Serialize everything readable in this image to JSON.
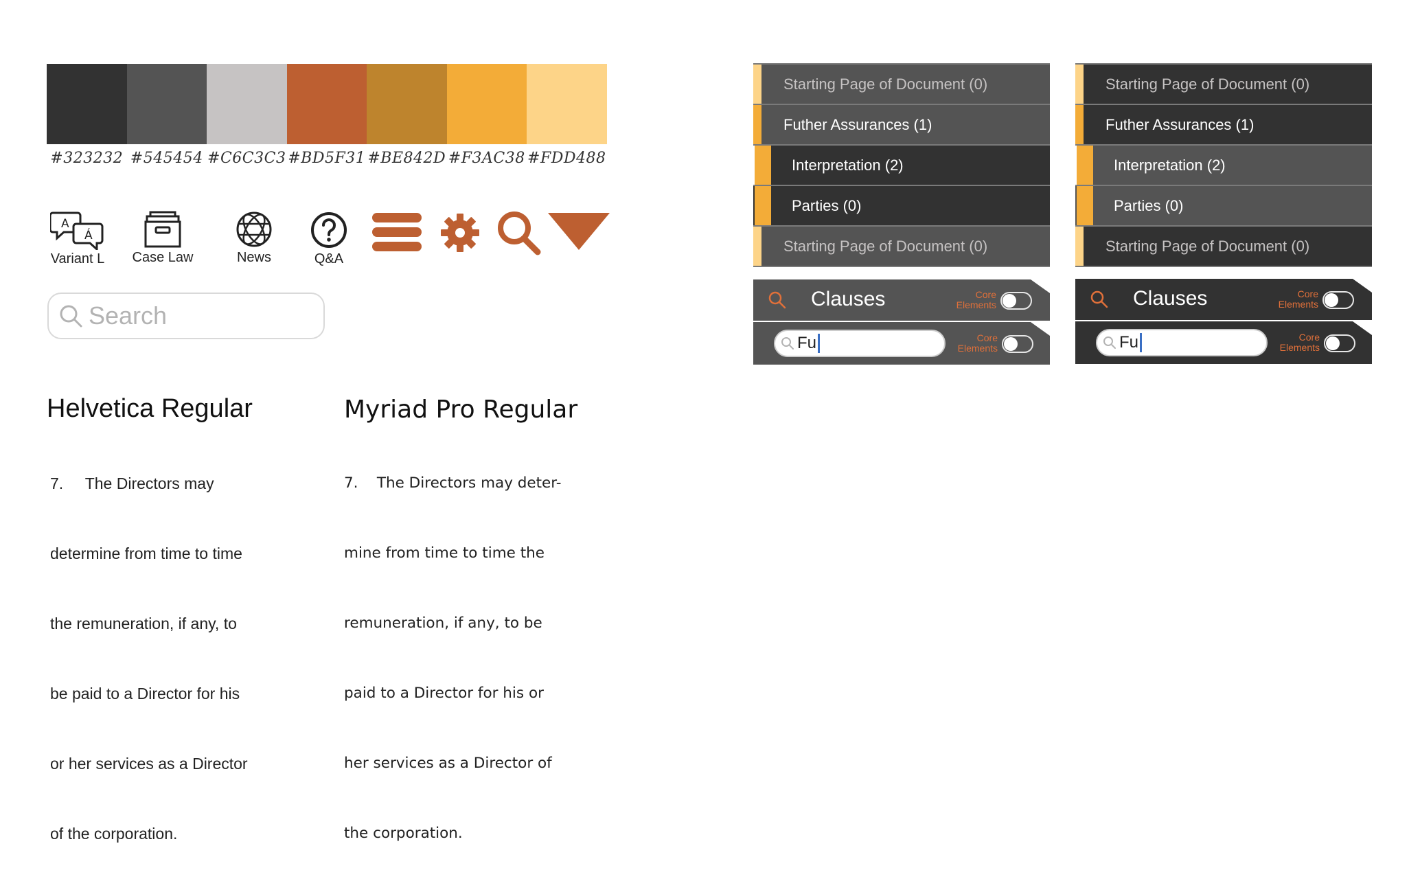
{
  "palette": [
    {
      "hex": "#323232",
      "label": "#323232"
    },
    {
      "hex": "#545454",
      "label": "#545454"
    },
    {
      "hex": "#C6C3C3",
      "label": "#C6C3C3"
    },
    {
      "hex": "#BD5F31",
      "label": "#BD5F31"
    },
    {
      "hex": "#BE842D",
      "label": "#BE842D"
    },
    {
      "hex": "#F3AC38",
      "label": "#F3AC38"
    },
    {
      "hex": "#FDD488",
      "label": "#FDD488"
    }
  ],
  "icons": {
    "variant": {
      "label": "Variant L",
      "icon": "translate-chat-icon"
    },
    "case_law": {
      "label": "Case Law",
      "icon": "archive-box-icon"
    },
    "news": {
      "label": "News",
      "icon": "globe-icon"
    },
    "qa": {
      "label": "Q&A",
      "icon": "question-circle-icon"
    },
    "menu": {
      "icon": "hamburger-menu-icon"
    },
    "settings": {
      "icon": "gear-icon"
    },
    "search": {
      "icon": "search-icon"
    },
    "dropdown": {
      "icon": "triangle-down-icon"
    }
  },
  "search": {
    "placeholder": "Search"
  },
  "typography": {
    "helvetica": {
      "title": "Helvetica Regular",
      "lines": [
        "7.     The Directors may",
        "determine from time to time",
        "the remuneration, if any, to",
        "be paid to a Director for his",
        "or her services as a Director",
        "of the corporation."
      ]
    },
    "myriad": {
      "title": "Myriad Pro Regular",
      "lines": [
        "7.    The Directors may deter-",
        "mine from time to time the",
        "remuneration, if any, to be",
        "paid to a Director for his or",
        "her services as a Director of",
        "the corporation."
      ]
    }
  },
  "panel_a": {
    "rows": [
      {
        "label": "Starting Page of Document (0)"
      },
      {
        "label": "Futher Assurances (1)"
      },
      {
        "label": "Interpretation (2)"
      },
      {
        "label": "Parties (0)"
      },
      {
        "label": "Starting Page of Document (0)"
      }
    ],
    "clauses": {
      "title": "Clauses",
      "core_line1": "Core",
      "core_line2": "Elements",
      "field_value": "Fu"
    }
  },
  "panel_b": {
    "rows": [
      {
        "label": "Starting Page of Document (0)"
      },
      {
        "label": "Futher Assurances (1)"
      },
      {
        "label": "Interpretation (2)"
      },
      {
        "label": "Parties (0)"
      },
      {
        "label": "Starting Page of Document (0)"
      }
    ],
    "clauses": {
      "title": "Clauses",
      "core_line1": "Core",
      "core_line2": "Elements",
      "field_value": "Fu"
    }
  }
}
